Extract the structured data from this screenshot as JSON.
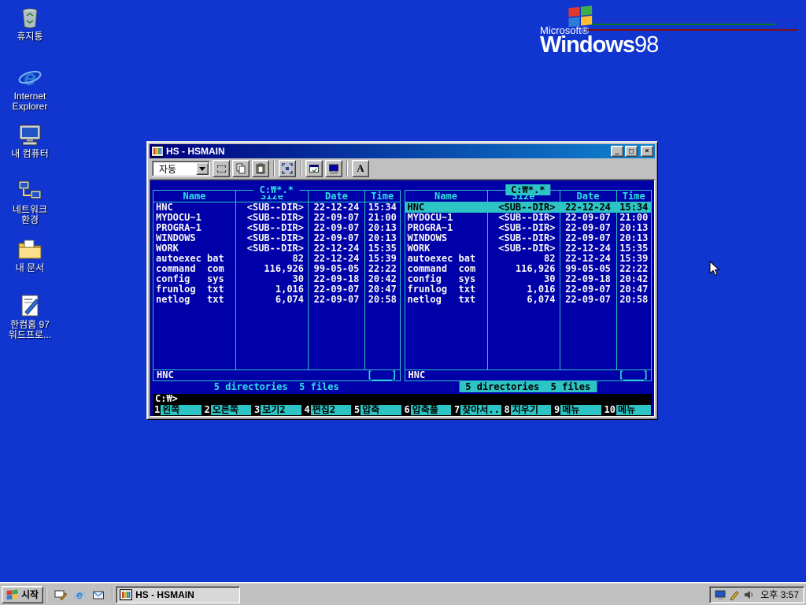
{
  "desktop": {
    "icons": [
      {
        "label": "휴지통"
      },
      {
        "label": "Internet Explorer"
      },
      {
        "label": "내 컴퓨터"
      },
      {
        "label": "네트워크 환경"
      },
      {
        "label": "내 문서"
      },
      {
        "label": "한컴홈 97 워드프로..."
      }
    ],
    "logo": {
      "brand": "Microsoft®",
      "name": "Windows",
      "version": "98"
    }
  },
  "window": {
    "title": "HS - HSMAIN",
    "controls": {
      "minimize": "_",
      "maximize": "□",
      "close": "×"
    },
    "toolbar": {
      "dropdown_value": "자동",
      "font_button": "A"
    }
  },
  "dos": {
    "path": "C:₩*.*",
    "columns": [
      "Name",
      "Size",
      "Date",
      "Time"
    ],
    "rows": [
      {
        "name": "HNC",
        "size": "<SUB--DIR>",
        "date": "22-12-24",
        "time": "15:34"
      },
      {
        "name": "MYDOCU~1",
        "size": "<SUB--DIR>",
        "date": "22-09-07",
        "time": "21:00"
      },
      {
        "name": "PROGRA~1",
        "size": "<SUB--DIR>",
        "date": "22-09-07",
        "time": "20:13"
      },
      {
        "name": "WINDOWS",
        "size": "<SUB--DIR>",
        "date": "22-09-07",
        "time": "20:13"
      },
      {
        "name": "WORK",
        "size": "<SUB--DIR>",
        "date": "22-12-24",
        "time": "15:35"
      },
      {
        "name": "autoexec bat",
        "size": "82",
        "date": "22-12-24",
        "time": "15:39"
      },
      {
        "name": "command  com",
        "size": "116,926",
        "date": "99-05-05",
        "time": "22:22"
      },
      {
        "name": "config   sys",
        "size": "30",
        "date": "22-09-18",
        "time": "20:42"
      },
      {
        "name": "frunlog  txt",
        "size": "1,016",
        "date": "22-09-07",
        "time": "20:47"
      },
      {
        "name": "netlog   txt",
        "size": "6,074",
        "date": "22-09-07",
        "time": "20:58"
      }
    ],
    "footer_dir": "HNC",
    "footer_gauge": "[____]",
    "status": "5 directories  5 files",
    "prompt": "C:₩>",
    "fkeys": [
      {
        "num": "1",
        "label": "왼쪽"
      },
      {
        "num": "2",
        "label": "오른쪽"
      },
      {
        "num": "3",
        "label": "보기2"
      },
      {
        "num": "4",
        "label": "편집2"
      },
      {
        "num": "5",
        "label": "압축"
      },
      {
        "num": "6",
        "label": "압축풀"
      },
      {
        "num": "7",
        "label": "찾아서.."
      },
      {
        "num": "8",
        "label": "지우기"
      },
      {
        "num": "9",
        "label": "메뉴"
      },
      {
        "num": "10",
        "label": "메뉴"
      }
    ]
  },
  "taskbar": {
    "start_label": "시작",
    "task_button": "HS - HSMAIN",
    "clock": "오후 3:57"
  }
}
